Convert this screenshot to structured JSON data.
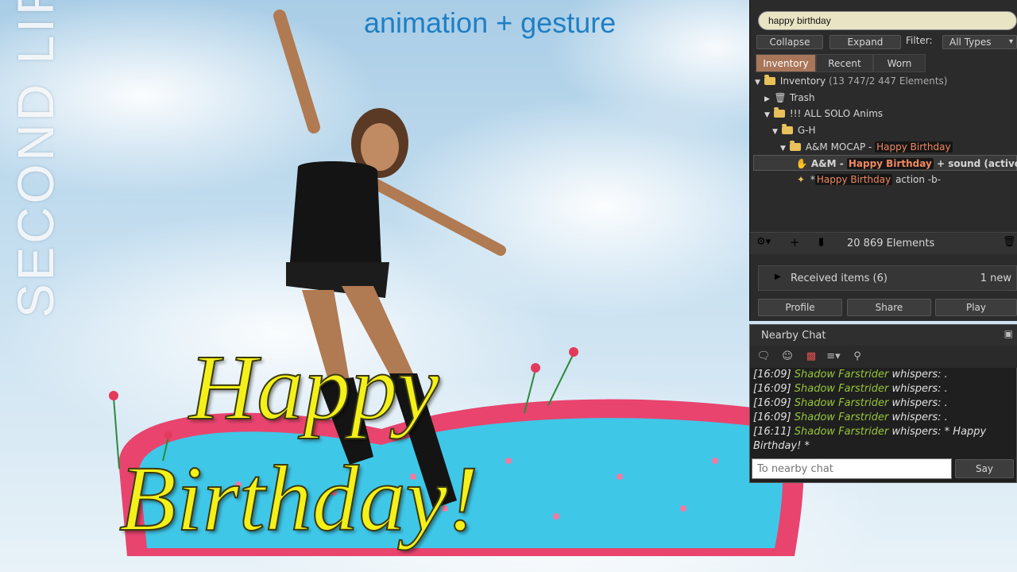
{
  "overlay": {
    "watermark": "SECOND LIFE",
    "video_title": "animation + gesture",
    "greeting_line1": "Happy",
    "greeting_line2": "Birthday!"
  },
  "inventory": {
    "search_value": "happy birthday",
    "collapse_label": "Collapse",
    "expand_label": "Expand",
    "filter_label": "Filter:",
    "filter_value": "All Types",
    "tabs": [
      "Inventory",
      "Recent",
      "Worn"
    ],
    "tree": {
      "root_label": "Inventory",
      "root_count": "(13 747/2 447 Elements)",
      "trash": "Trash",
      "solo": "!!! ALL SOLO Anims",
      "gh": "G-H",
      "mocap_prefix": "A&M MOCAP - ",
      "mocap_hl": "Happy Birthday",
      "item1_prefix": "A&M - ",
      "item1_hl": "Happy Birthday",
      "item1_suffix": " + sound (active",
      "item2_prefix": "*",
      "item2_hl": "Happy Birthday",
      "item2_suffix": " action -b-"
    },
    "elements_count": "20 869 Elements",
    "received_label": "Received items (6)",
    "received_new": "1 new",
    "profile_label": "Profile",
    "share_label": "Share",
    "play_label": "Play"
  },
  "chat": {
    "title": "Nearby Chat",
    "messages": [
      {
        "time": "[16:09]",
        "name": "Shadow Farstrider",
        "text": "whispers: ."
      },
      {
        "time": "[16:09]",
        "name": "Shadow Farstrider",
        "text": "whispers: ."
      },
      {
        "time": "[16:09]",
        "name": "Shadow Farstrider",
        "text": "whispers: ."
      },
      {
        "time": "[16:09]",
        "name": "Shadow Farstrider",
        "text": "whispers: ."
      },
      {
        "time": "[16:11]",
        "name": "Shadow Farstrider",
        "text": "whispers: * Happy"
      }
    ],
    "last_line_cont": "Birthday! *",
    "input_placeholder": "To nearby chat",
    "say_label": "Say"
  },
  "colors": {
    "accent_tab": "#a9765a",
    "highlight_text": "#f08860",
    "chat_name": "#97c43a",
    "greeting": "#f4f01a",
    "title_blue": "#1f7fc4"
  }
}
